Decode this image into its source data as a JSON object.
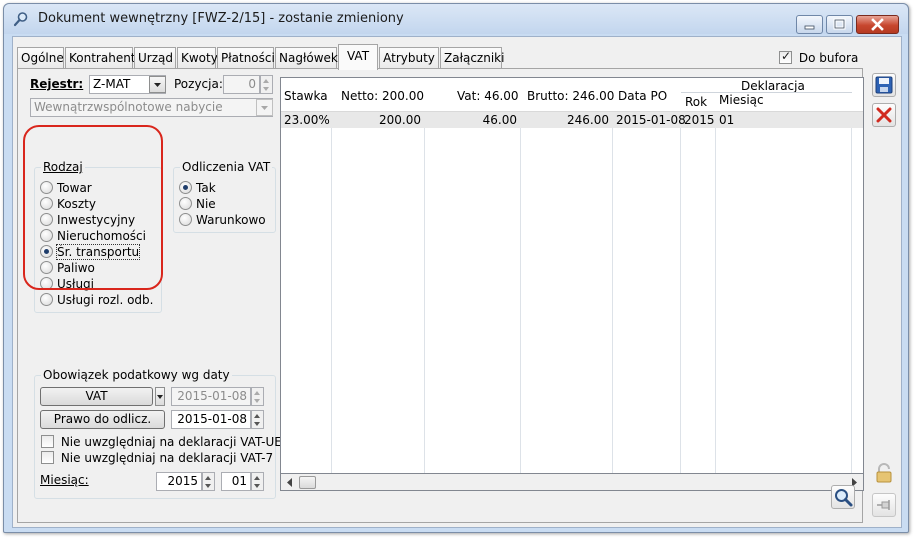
{
  "window": {
    "title": "Dokument wewnętrzny [FWZ-2/15]  - zostanie zmieniony"
  },
  "tabs": [
    "Ogólne",
    "Kontrahent",
    "Urząd",
    "Kwoty",
    "Płatności",
    "Nagłówek",
    "VAT",
    "Atrybuty",
    "Załączniki"
  ],
  "active_tab": "VAT",
  "do_bufora": {
    "label": "Do bufora",
    "checked": true
  },
  "rejestr": {
    "label": "Rejestr:",
    "value": "Z-MAT"
  },
  "pozycja": {
    "label": "Pozycja:",
    "value": "0"
  },
  "register_desc": "Wewnątrzwspólnotowe nabycie",
  "rodzaj": {
    "legend": "Rodzaj",
    "options": [
      "Towar",
      "Koszty",
      "Inwestycyjny",
      "Nieruchomości",
      "Śr. transportu",
      "Paliwo",
      "Usługi",
      "Usługi rozl. odb."
    ],
    "selected": "Śr. transportu"
  },
  "odliczenia": {
    "legend": "Odliczenia VAT",
    "options": [
      "Tak",
      "Nie",
      "Warunkowo"
    ],
    "selected": "Tak"
  },
  "obowiazek": {
    "legend": "Obowiązek podatkowy wg daty",
    "vat_button": "VAT",
    "vat_date": "2015-01-08",
    "prawo_button": "Prawo do odlicz.",
    "prawo_date": "2015-01-08",
    "chk_vat_ue": "Nie uwzględniaj na deklaracji VAT-UE",
    "chk_vat_7": "Nie uwzględniaj na deklaracji VAT-7",
    "miesiac_label": "Miesiąc:",
    "year": "2015",
    "month": "01"
  },
  "grid": {
    "headers": {
      "stawka": "Stawka",
      "netto": "Netto: 200.00",
      "vat": "Vat: 46.00",
      "brutto": "Brutto: 246.00",
      "data_po": "Data PO",
      "deklaracja": "Deklaracja",
      "rok": "Rok",
      "miesiac": "Miesiąc"
    },
    "rows": [
      {
        "stawka": "23.00%",
        "netto": "200.00",
        "vat": "46.00",
        "brutto": "246.00",
        "data_po": "2015-01-08",
        "rok": "2015",
        "miesiac": "01"
      }
    ]
  }
}
